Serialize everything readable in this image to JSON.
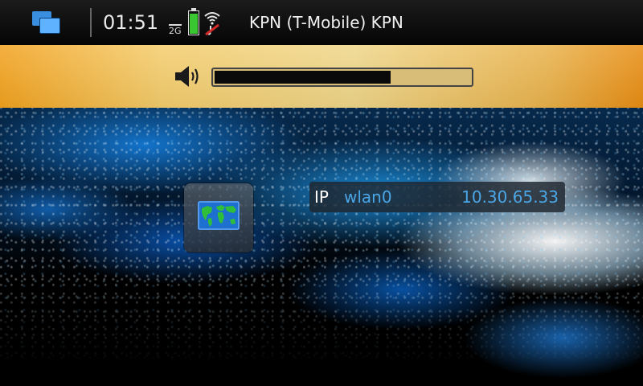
{
  "status_bar": {
    "time": "01:51",
    "network_type": "2G",
    "operator": "KPN (T-Mobile)  KPN",
    "battery_level": 1.0,
    "battery_color": "#39c630",
    "icons": [
      "task-switcher-icon",
      "battery-icon",
      "wifi-disconnected-icon"
    ]
  },
  "volume": {
    "level": 0.69,
    "icon": "speaker-icon",
    "accent_color": "#f4cc6b"
  },
  "desktop": {
    "shortcut_icon": "world-map-icon",
    "ip_widget": {
      "label": "IP",
      "interface": "wlan0",
      "address": "10.30.65.33",
      "value_color": "#4aa6e6"
    }
  }
}
